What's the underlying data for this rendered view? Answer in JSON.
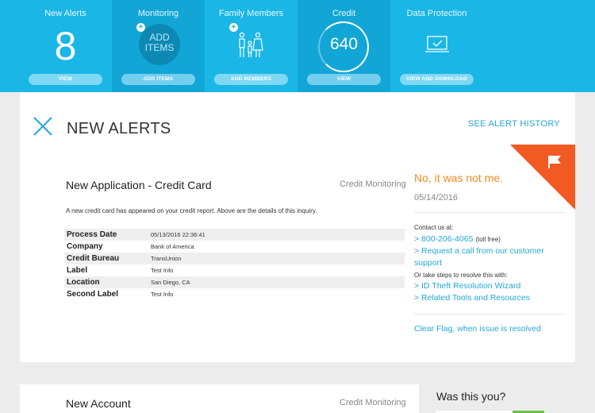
{
  "tiles": [
    {
      "title": "New Alerts",
      "value": "8",
      "button": "VIEW"
    },
    {
      "title": "Monitoring",
      "circle_text": "ADD ITEMS",
      "button": "ADD ITEMS"
    },
    {
      "title": "Family Members",
      "button": "ADD MEMBERS"
    },
    {
      "title": "Credit",
      "value": "640",
      "button": "VIEW"
    },
    {
      "title": "Data Protection",
      "button": "VIEW AND DOWNLOAD"
    }
  ],
  "panel": {
    "title": "NEW ALERTS",
    "history_link": "SEE ALERT HISTORY"
  },
  "alert": {
    "title": "New Application - Credit Card",
    "category": "Credit Monitoring",
    "description": "A new credit card has appeared on your credit report. Above are the details of this inquiry.",
    "details": [
      {
        "label": "Process Date",
        "value": "05/13/2016 22:36:41"
      },
      {
        "label": "Company",
        "value": "Bank of America"
      },
      {
        "label": "Credit Bureau",
        "value": "TransUnion"
      },
      {
        "label": "Label",
        "value": "Test Info"
      },
      {
        "label": "Location",
        "value": "San Diego, CA"
      },
      {
        "label": "Second Label",
        "value": "Test Info"
      }
    ]
  },
  "side": {
    "not_me": "No, it was not me.",
    "date": "05/14/2016",
    "contact_label": "Contact us at:",
    "phone": "> 800-206-4065",
    "toll_free": "(toll free)",
    "request_call": "> Request a call from our customer support",
    "steps_label": "Or take steps to resolve this with:",
    "wizard": "> ID Theft Resolution Wizard",
    "tools": "> Related Tools and Resources",
    "clear_flag": "Clear Flag, when issue is resolved"
  },
  "next": {
    "title": "New Account",
    "category": "Credit Monitoring",
    "was_you": "Was this you?"
  },
  "colors": {
    "topbar": "#1ab6e6",
    "accent_link": "#22a8d8",
    "flag": "#f15a22",
    "not_me": "#f38b1e"
  },
  "icons": [
    "plus-icon",
    "family-icon",
    "laptop-check-icon",
    "close-icon",
    "flag-icon"
  ]
}
